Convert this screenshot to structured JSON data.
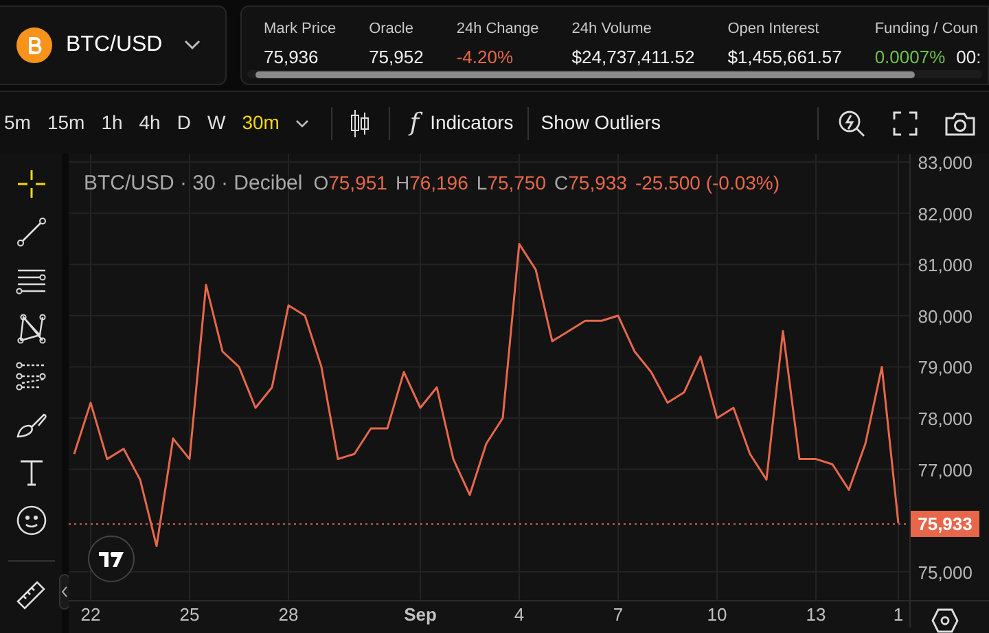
{
  "market": {
    "symbol": "BTC/USD"
  },
  "stats": [
    {
      "label": "Mark Price",
      "value": "75,936"
    },
    {
      "label": "Oracle",
      "value": "75,952"
    },
    {
      "label": "24h Change",
      "value": "-4.20%",
      "color": "#e8674a"
    },
    {
      "label": "24h Volume",
      "value": "$24,737,411.52"
    },
    {
      "label": "Open Interest",
      "value": "$1,455,661.57"
    },
    {
      "label": "Funding / Coun",
      "value": "0.0007%",
      "color": "#6cc24a",
      "extra": "00:"
    }
  ],
  "intervals": [
    {
      "label": "5m",
      "selected": false
    },
    {
      "label": "15m",
      "selected": false
    },
    {
      "label": "1h",
      "selected": false
    },
    {
      "label": "4h",
      "selected": false
    },
    {
      "label": "D",
      "selected": false
    },
    {
      "label": "W",
      "selected": false
    },
    {
      "label": "30m",
      "selected": true
    }
  ],
  "toolbar": {
    "indicators": "Indicators",
    "outliers": "Show Outliers",
    "fx": "f"
  },
  "tools": [
    {
      "kind": "crosshair",
      "selected": true
    },
    {
      "kind": "trendline",
      "selected": false
    },
    {
      "kind": "fib",
      "selected": false
    },
    {
      "kind": "pattern",
      "selected": false
    },
    {
      "kind": "projection",
      "selected": false
    },
    {
      "kind": "brush",
      "selected": false
    },
    {
      "kind": "text",
      "selected": false
    },
    {
      "kind": "emoji",
      "selected": false
    },
    {
      "kind": "ruler",
      "selected": false
    }
  ],
  "legend": {
    "title": "BTC/USD · 30 · Decibel",
    "items": [
      {
        "key": "O",
        "value": "75,951"
      },
      {
        "key": "H",
        "value": "76,196"
      },
      {
        "key": "L",
        "value": "75,750"
      },
      {
        "key": "C",
        "value": "75,933"
      }
    ],
    "change": "-25.500 (-0.03%)"
  },
  "last_price": "75,933",
  "chart_data": {
    "type": "line",
    "categories": [
      null,
      "22",
      null,
      null,
      null,
      null,
      null,
      "25",
      null,
      null,
      null,
      null,
      null,
      "28",
      null,
      null,
      null,
      null,
      null,
      null,
      null,
      "Sep",
      null,
      null,
      null,
      null,
      null,
      "4",
      null,
      null,
      null,
      null,
      null,
      "7",
      null,
      null,
      null,
      null,
      null,
      "10",
      null,
      null,
      null,
      null,
      null,
      "13",
      null,
      null,
      null,
      null,
      "1"
    ],
    "ylim": [
      74500,
      83200
    ],
    "grid": true,
    "ref_lines": [
      {
        "axis": "y",
        "value": 75933,
        "color": "#e8674a"
      }
    ],
    "series": [
      {
        "color": "#e8674a",
        "values": [
          77300,
          78300,
          77200,
          77400,
          76800,
          75500,
          77600,
          77200,
          80600,
          79300,
          79000,
          78200,
          78600,
          80200,
          80000,
          79000,
          77200,
          77300,
          77800,
          77800,
          78900,
          78200,
          78600,
          77200,
          76500,
          77500,
          78000,
          81400,
          80900,
          79500,
          79700,
          79900,
          79900,
          80000,
          79300,
          78900,
          78300,
          78500,
          79200,
          78000,
          78200,
          77300,
          76800,
          79700,
          77200,
          77200,
          77100,
          76600,
          77500,
          79000,
          75950
        ]
      }
    ],
    "yticks": [
      {
        "value": 75000,
        "label": "75,000"
      },
      {
        "value": 77000,
        "label": "77,000"
      },
      {
        "value": 78000,
        "label": "78,000"
      },
      {
        "value": 79000,
        "label": "79,000"
      },
      {
        "value": 80000,
        "label": "80,000"
      },
      {
        "value": 81000,
        "label": "81,000"
      },
      {
        "value": 82000,
        "label": "82,000"
      },
      {
        "value": 83000,
        "label": "83,000"
      }
    ]
  }
}
